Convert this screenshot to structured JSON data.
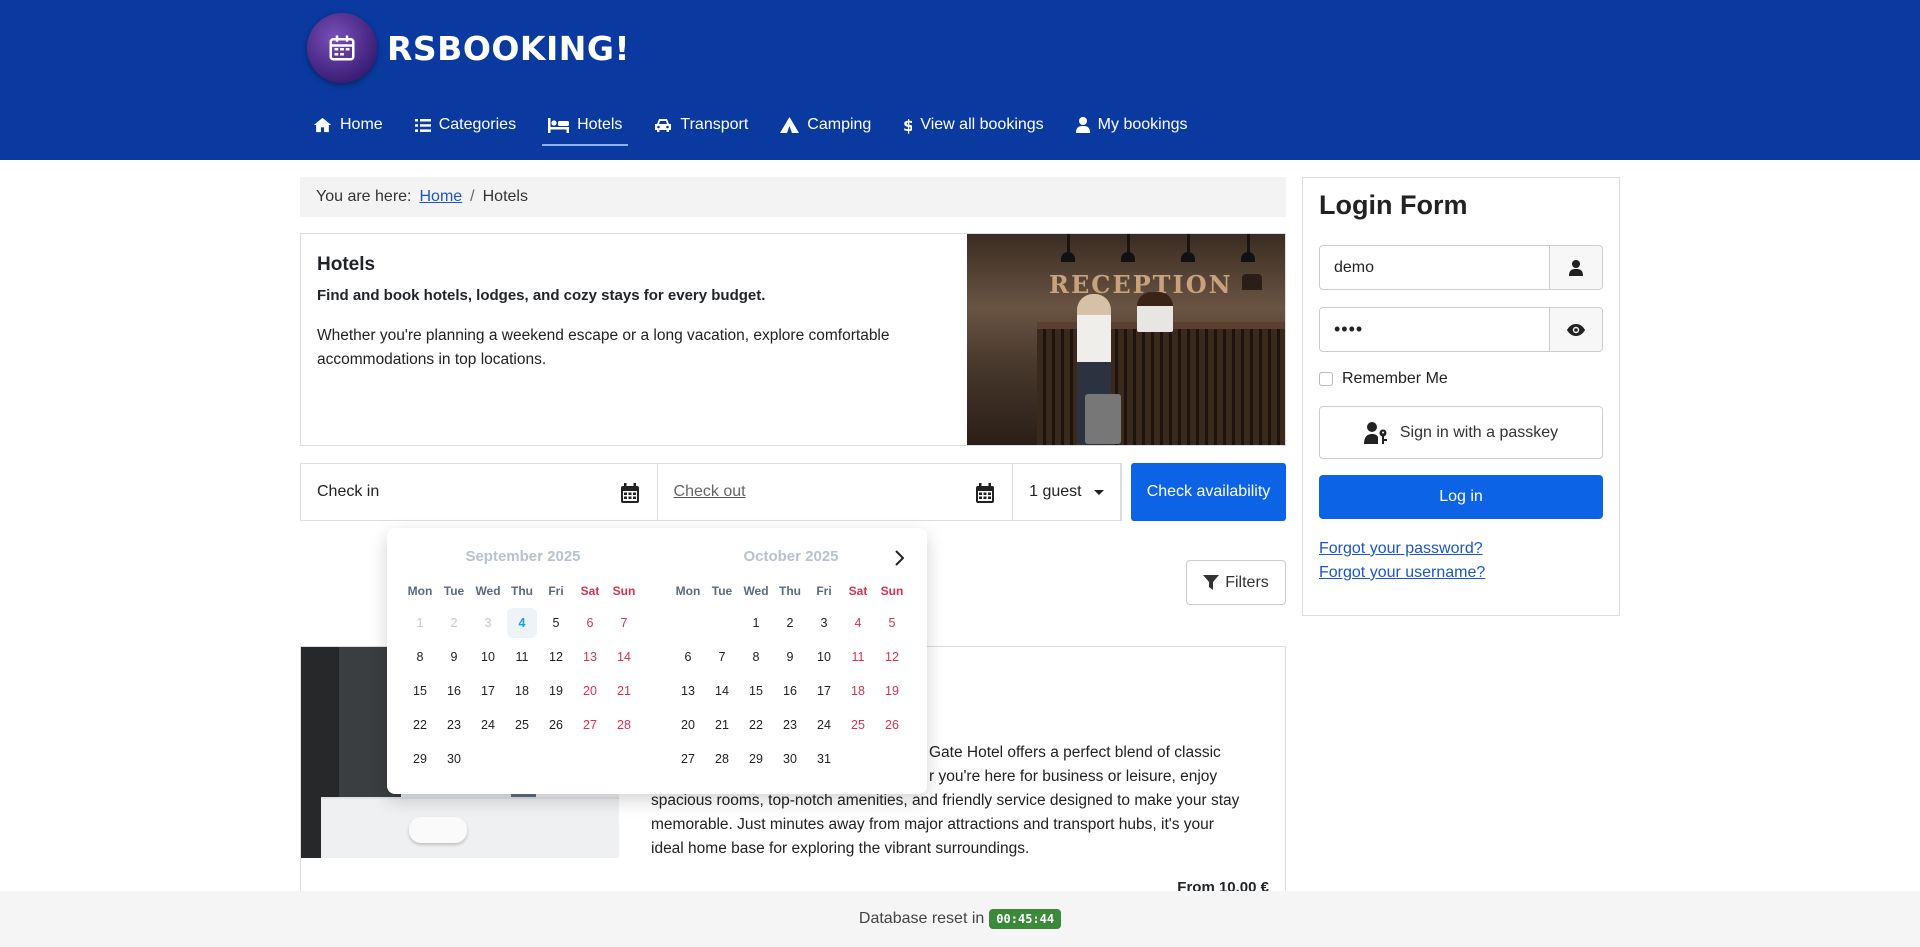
{
  "brand": {
    "name": "RSBOOKING!"
  },
  "nav": {
    "items": [
      {
        "label": "Home",
        "icon": "home-icon"
      },
      {
        "label": "Categories",
        "icon": "list-icon"
      },
      {
        "label": "Hotels",
        "icon": "bed-icon",
        "active": true
      },
      {
        "label": "Transport",
        "icon": "car-icon"
      },
      {
        "label": "Camping",
        "icon": "tent-icon"
      },
      {
        "label": "View all bookings",
        "icon": "dollar-icon"
      },
      {
        "label": "My bookings",
        "icon": "user-icon"
      }
    ]
  },
  "breadcrumb": {
    "prefix": "You are here:",
    "home": "Home",
    "sep": "/",
    "current": "Hotels"
  },
  "intro": {
    "title": "Hotels",
    "lead": "Find and book hotels, lodges, and cozy stays for every budget.",
    "description": "Whether you're planning a weekend escape or a long vacation, explore comfortable accommodations in top locations.",
    "image_text": "RECEPTION"
  },
  "search": {
    "check_in": "Check in",
    "check_out": "Check out",
    "guests": "1 guest",
    "button": "Check availability"
  },
  "filters": {
    "label": "Filters"
  },
  "hotel": {
    "description_visible": "Gate Hotel offers a perfect blend of classic r you're here for business or leisure, enjoy spacious rooms, top-notch amenities, and friendly service designed to make your stay memorable. Just minutes away from major attractions and transport hubs, it's your ideal home base for exploring the vibrant surroundings.",
    "line1": "Gate Hotel offers a perfect blend of classic",
    "line2": "r you're here for business or leisure, enjoy",
    "line3": "spacious rooms, top-notch amenities, and friendly service designed to make your stay",
    "line4": "memorable. Just minutes away from major attractions and transport hubs, it's your",
    "line5": "ideal home base for exploring the vibrant surroundings.",
    "price": "From 10.00 €"
  },
  "calendar": {
    "weekdays": [
      "Mon",
      "Tue",
      "Wed",
      "Thu",
      "Fri",
      "Sat",
      "Sun"
    ],
    "months": [
      {
        "title": "September  2025",
        "offset": 0,
        "days": 30,
        "today": 4
      },
      {
        "title": "October  2025",
        "offset": 2,
        "days": 31,
        "today": 0
      }
    ]
  },
  "login": {
    "title": "Login Form",
    "username": "demo",
    "password_mask": "••••",
    "remember": "Remember Me",
    "passkey": "Sign in with a passkey",
    "submit": "Log in",
    "forgot_password": "Forgot your password?",
    "forgot_username": "Forgot your username?"
  },
  "footer": {
    "text": "Database reset in",
    "timer": "00:45:44"
  },
  "colors": {
    "header": "#0a3aa0",
    "primary": "#0d63e5",
    "weekend": "#d6324f",
    "badge": "#3a8a3a"
  }
}
